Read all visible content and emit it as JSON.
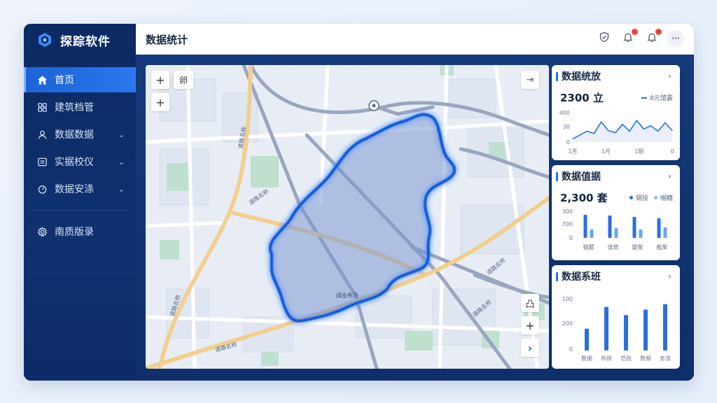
{
  "app": {
    "brand": "探踪软件",
    "page_title": "数据统计"
  },
  "sidebar": {
    "items": [
      {
        "label": "首页",
        "active": true,
        "chevron": false
      },
      {
        "label": "建筑档管",
        "active": false,
        "chevron": false
      },
      {
        "label": "数据数据",
        "active": false,
        "chevron": true
      },
      {
        "label": "实据校仪",
        "active": false,
        "chevron": true
      },
      {
        "label": "数据安涤",
        "active": false,
        "chevron": true
      },
      {
        "label": "南质版录",
        "active": false,
        "chevron": false
      }
    ]
  },
  "topbar": {
    "badge_1": "",
    "badge_2": "",
    "more": "···"
  },
  "map": {
    "zoom_in": "+",
    "zoom_in_2": "+",
    "layer_label": "卵",
    "share_icon": "⇥",
    "ctrl_label": "凸",
    "ctrl_plus": "+",
    "ctrl_next": "›",
    "area_label": "阔业布乃"
  },
  "panels": {
    "p1": {
      "title": "数据统放",
      "value": "2300 立",
      "legend": "8元馆露",
      "y_ticks": [
        "400",
        "30",
        "0"
      ],
      "x_ticks": [
        "1月",
        "1月",
        "1期",
        "0"
      ],
      "accent": "#2a6fe0"
    },
    "p2": {
      "title": "数据值据",
      "value": "2,300 套",
      "legend_a": "钢技",
      "legend_b": "帽糖",
      "y_ticks": [
        "300",
        "700",
        "0"
      ],
      "x_ticks": [
        "锄麓",
        "號燃",
        "變聚",
        "截聚"
      ],
      "color_a": "#2a6fe0",
      "color_b": "#6aa5f5"
    },
    "p3": {
      "title": "数据系班",
      "y_ticks": [
        "100",
        "200",
        "0"
      ],
      "x_ticks": [
        "数据",
        "帝颉",
        "范验",
        "数频",
        "务漆"
      ],
      "color": "#2a6fe0"
    }
  },
  "chart_data": [
    {
      "type": "line",
      "title": "数据统放",
      "series": [
        {
          "name": "8元馆露",
          "values": [
            40,
            90,
            140,
            110,
            260,
            150,
            120,
            230,
            140,
            280,
            170,
            210,
            140,
            250,
            150
          ]
        }
      ],
      "ylim": [
        0,
        400
      ]
    },
    {
      "type": "bar",
      "title": "数据值据",
      "categories": [
        "锄麓",
        "號燃",
        "變聚",
        "截聚"
      ],
      "series": [
        {
          "name": "钢技",
          "values": [
            330,
            320,
            300,
            280
          ]
        },
        {
          "name": "帽糖",
          "values": [
            120,
            140,
            120,
            150
          ]
        }
      ]
    },
    {
      "type": "bar",
      "title": "数据系班",
      "categories": [
        "数据",
        "帝颉",
        "范验",
        "数频",
        "务漆"
      ],
      "series": [
        {
          "values": [
            80,
            160,
            130,
            150,
            170
          ]
        }
      ]
    }
  ]
}
